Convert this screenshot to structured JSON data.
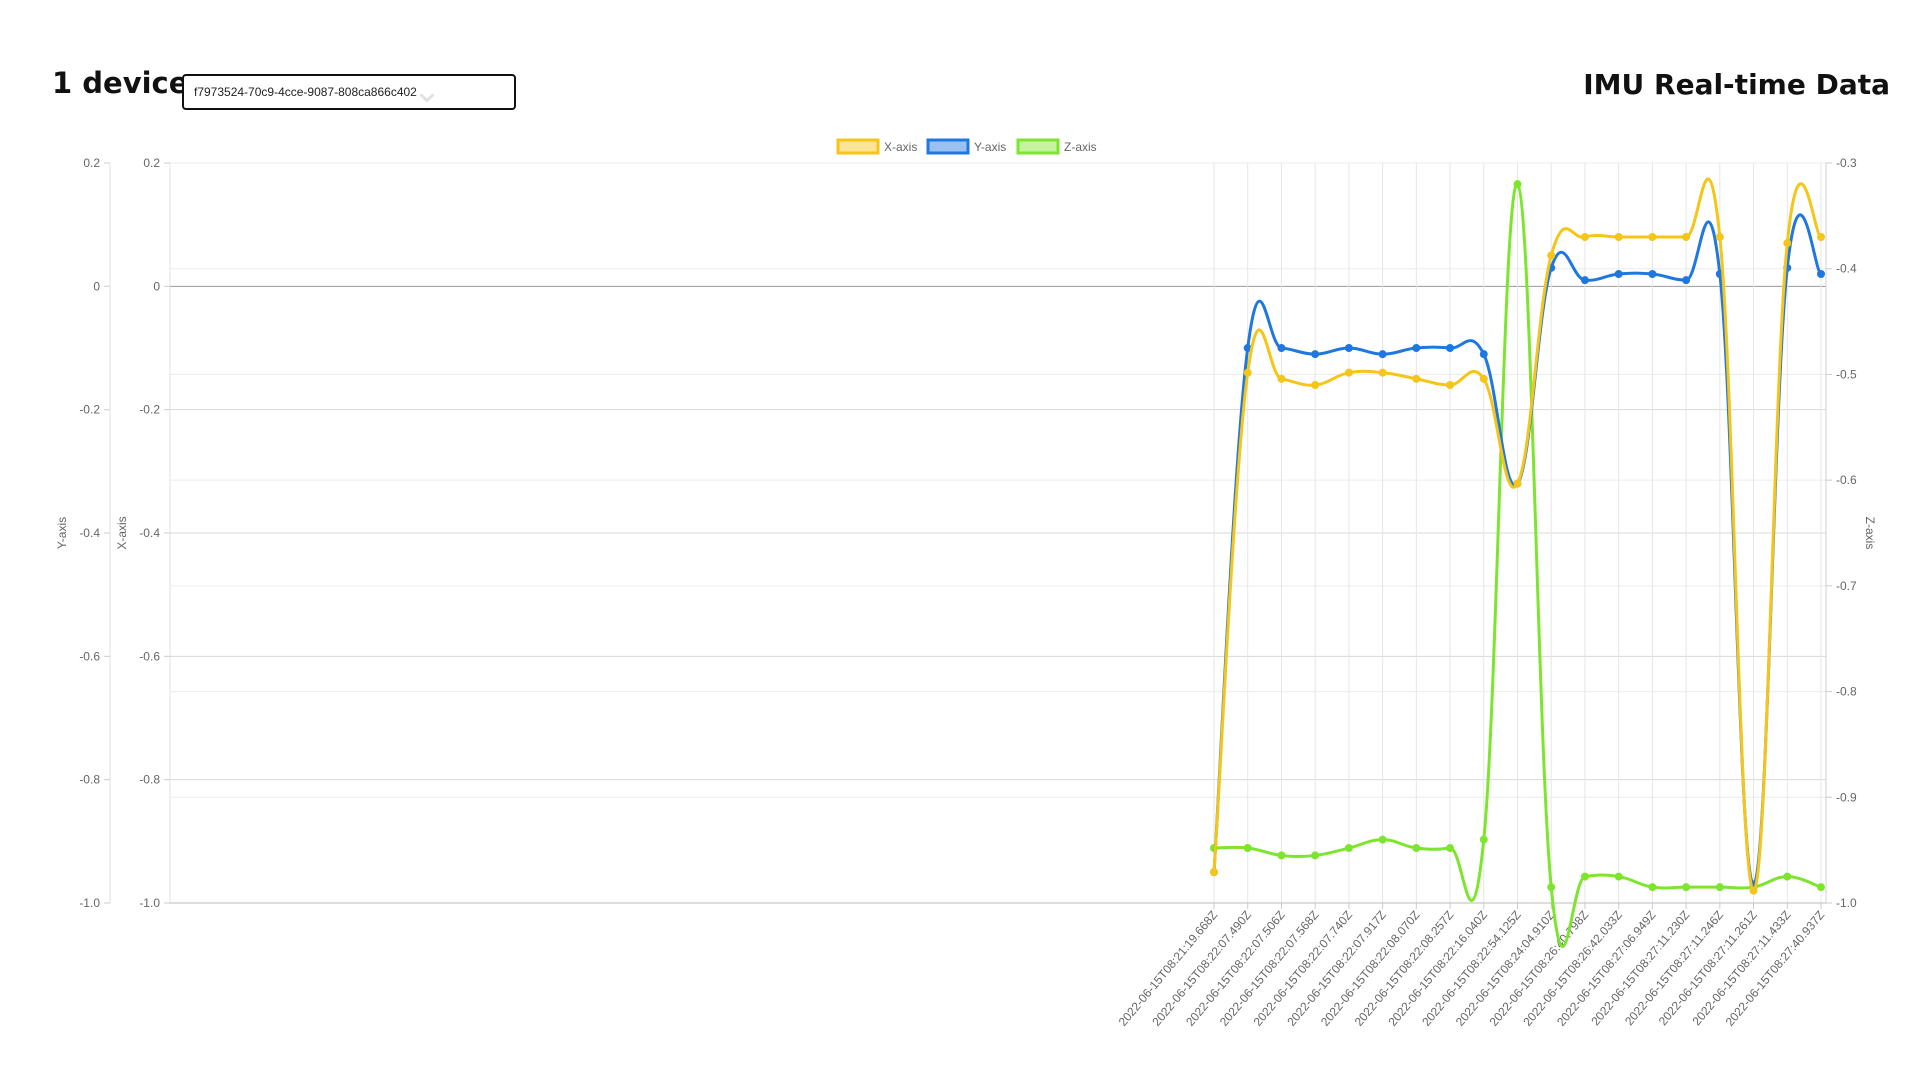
{
  "header": {
    "device_count": "1 device",
    "device_id": "f7973524-70c9-4cce-9087-808ca866c402",
    "title": "IMU Real-time Data"
  },
  "colors": {
    "x_axis": "#f5c518",
    "y_axis": "#1f77e0",
    "z_axis": "#7ee52f"
  },
  "chart_data": {
    "type": "line",
    "x": [
      "2022-06-15T08:21:19.668Z",
      "2022-06-15T08:22:07.490Z",
      "2022-06-15T08:22:07.506Z",
      "2022-06-15T08:22:07.568Z",
      "2022-06-15T08:22:07.740Z",
      "2022-06-15T08:22:07.917Z",
      "2022-06-15T08:22:08.070Z",
      "2022-06-15T08:22:08.257Z",
      "2022-06-15T08:22:16.040Z",
      "2022-06-15T08:22:54.125Z",
      "2022-06-15T08:24:04.910Z",
      "2022-06-15T08:26:40.798Z",
      "2022-06-15T08:26:42.033Z",
      "2022-06-15T08:27:06.949Z",
      "2022-06-15T08:27:11.230Z",
      "2022-06-15T08:27:11.246Z",
      "2022-06-15T08:27:11.261Z",
      "2022-06-15T08:27:11.433Z",
      "2022-06-15T08:27:40.937Z"
    ],
    "series": [
      {
        "name": "X-axis",
        "axis": "x-left",
        "values": [
          -0.95,
          -0.14,
          -0.15,
          -0.16,
          -0.14,
          -0.14,
          -0.15,
          -0.16,
          -0.15,
          -0.32,
          0.05,
          0.08,
          0.08,
          0.08,
          0.08,
          0.08,
          -0.98,
          0.07,
          0.08
        ]
      },
      {
        "name": "Y-axis",
        "axis": "y-left",
        "values": [
          -0.95,
          -0.1,
          -0.1,
          -0.11,
          -0.1,
          -0.11,
          -0.1,
          -0.1,
          -0.11,
          -0.32,
          0.03,
          0.01,
          0.02,
          0.02,
          0.01,
          0.02,
          -0.97,
          0.03,
          0.02
        ]
      },
      {
        "name": "Z-axis",
        "axis": "z-right",
        "values": [
          -0.948,
          -0.948,
          -0.955,
          -0.955,
          -0.948,
          -0.94,
          -0.948,
          -0.948,
          -0.94,
          -0.32,
          -0.985,
          -0.975,
          -0.975,
          -0.985,
          -0.985,
          -0.985,
          -0.985,
          -0.975,
          -0.985
        ]
      }
    ],
    "y_axis_left": {
      "title": "Y-axis",
      "ylim": [
        -1.0,
        0.2
      ],
      "ticks": [
        "0.2",
        "0",
        "-0.2",
        "-0.4",
        "-0.6",
        "-0.8",
        "-1.0"
      ]
    },
    "x_axis_left": {
      "title": "X-axis",
      "ylim": [
        -1.0,
        0.2
      ],
      "ticks": [
        "0.2",
        "0",
        "-0.2",
        "-0.4",
        "-0.6",
        "-0.8",
        "-1.0"
      ]
    },
    "z_axis_right": {
      "title": "Z-axis",
      "ylim": [
        -1.0,
        -0.3
      ],
      "ticks": [
        "-0.3",
        "-0.4",
        "-0.5",
        "-0.6",
        "-0.7",
        "-0.8",
        "-0.9",
        "-1.0"
      ]
    },
    "legend": {
      "position": "top",
      "entries": [
        "X-axis",
        "Y-axis",
        "Z-axis"
      ]
    },
    "grid": true
  }
}
